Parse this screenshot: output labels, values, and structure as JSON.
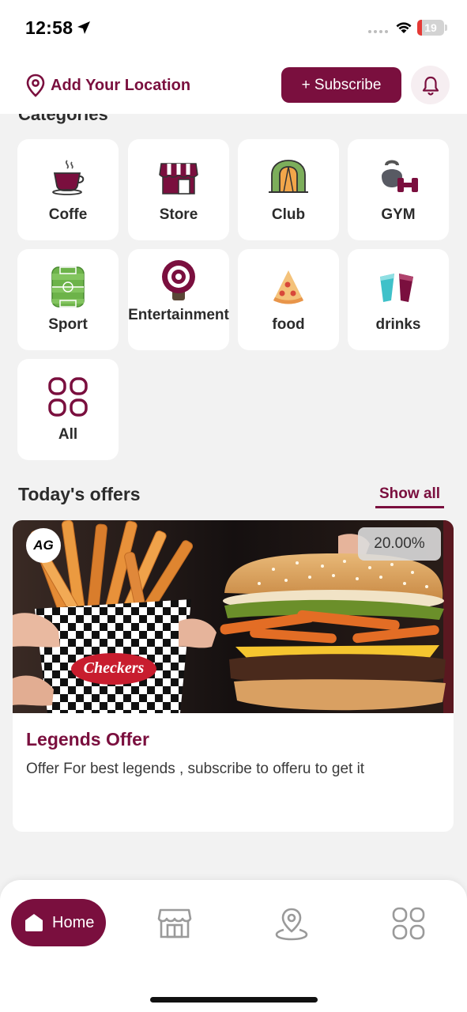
{
  "status_bar": {
    "time": "12:58",
    "battery": "19",
    "battery_level": 0.19
  },
  "header": {
    "location_label": "Add Your Location",
    "subscribe_label": "+ Subscribe"
  },
  "categories": {
    "title": "Categories",
    "items": [
      {
        "label": "Coffe",
        "icon": "coffee-cup-icon"
      },
      {
        "label": "Store",
        "icon": "store-icon"
      },
      {
        "label": "Club",
        "icon": "club-icon"
      },
      {
        "label": "GYM",
        "icon": "gym-icon"
      },
      {
        "label": "Sport",
        "icon": "sport-field-icon"
      },
      {
        "label": "Entertainment",
        "icon": "entertainment-icon"
      },
      {
        "label": "food",
        "icon": "pizza-icon"
      },
      {
        "label": "drinks",
        "icon": "drinks-icon"
      },
      {
        "label": "All",
        "icon": "grid-icon"
      }
    ]
  },
  "offers": {
    "title": "Today's offers",
    "show_all_label": "Show all",
    "items": [
      {
        "logo": "AG",
        "discount": "20.00%",
        "name": "Legends Offer",
        "description": "Offer For best legends , subscribe to offeru to get it",
        "image_text": "Checkers"
      }
    ]
  },
  "bottom_nav": {
    "home_label": "Home"
  },
  "colors": {
    "brand": "#7a0f3e",
    "background": "#f2f2f2"
  }
}
